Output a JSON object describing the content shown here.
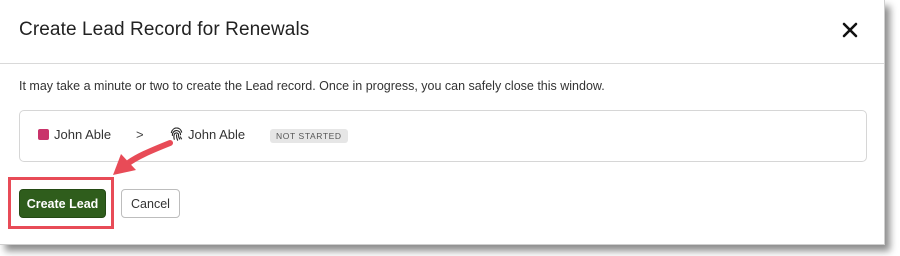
{
  "dialog": {
    "title": "Create Lead Record for Renewals",
    "close_icon": "close-icon",
    "info_text": "It may take a minute or two to create the Lead record. Once in progress, you can safely close this window."
  },
  "record": {
    "source_name": "John Able",
    "source_swatch_color": "#c9336a",
    "separator": ">",
    "target_icon": "fingerprint-icon",
    "target_name": "John Able",
    "status": "NOT STARTED"
  },
  "actions": {
    "create_label": "Create Lead",
    "cancel_label": "Cancel",
    "create_color": "#2f5d1c"
  },
  "annotation": {
    "callout_color": "#e84b57"
  }
}
